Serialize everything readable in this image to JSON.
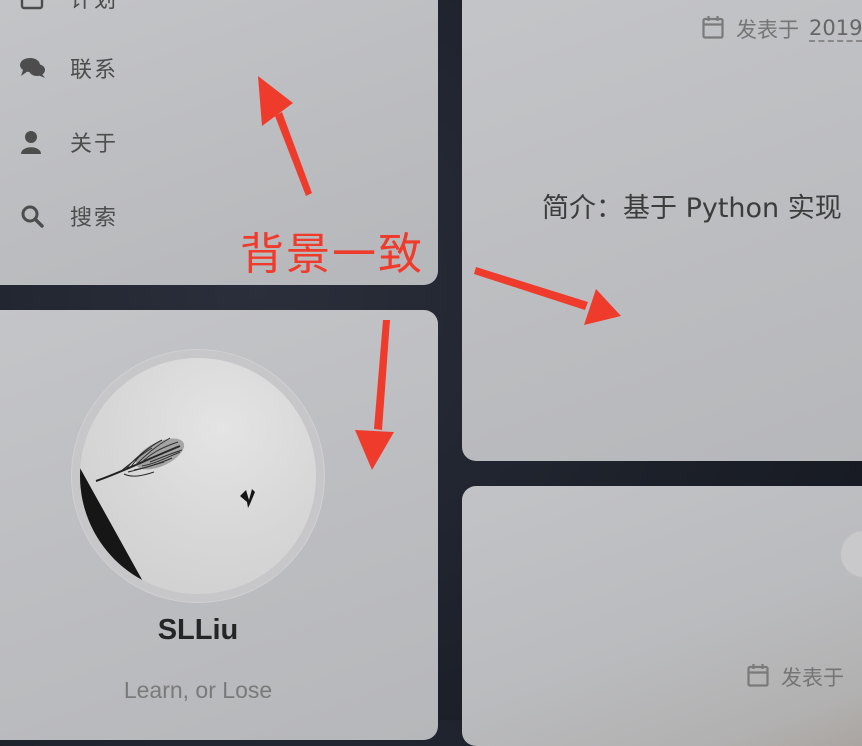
{
  "sidebar": {
    "items": [
      {
        "label": "计划",
        "icon": "calendar-icon"
      },
      {
        "label": "联系",
        "icon": "comments-icon"
      },
      {
        "label": "关于",
        "icon": "user-icon"
      },
      {
        "label": "搜索",
        "icon": "search-icon"
      }
    ]
  },
  "profile": {
    "name": "SLLiu",
    "description": "Learn, or Lose",
    "avatar_icon": "avatar-feather-bird-image"
  },
  "posts": [
    {
      "meta_label": "发表于",
      "date": "2019",
      "excerpt": "简介：基于 Python 实现"
    },
    {
      "meta_label": "发表于"
    }
  ],
  "annotation": {
    "text": "背景一致",
    "color": "#ef3b2c"
  }
}
